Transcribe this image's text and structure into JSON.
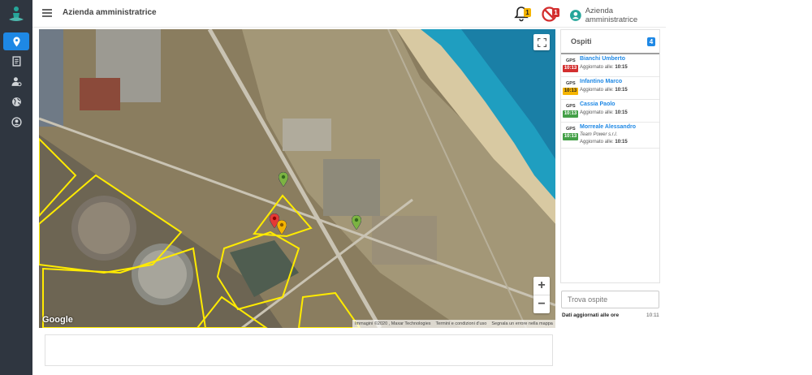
{
  "header": {
    "company": "Azienda amministratrice",
    "user_name": "Azienda amministratrice",
    "notification_count": "1",
    "blocked_count": "1"
  },
  "sidebar": {
    "items": [
      {
        "icon": "location-pin-icon",
        "active": true
      },
      {
        "icon": "document-icon"
      },
      {
        "icon": "user-settings-icon"
      },
      {
        "icon": "globe-icon"
      },
      {
        "icon": "user-circle-icon"
      }
    ]
  },
  "map": {
    "logo": "Google",
    "attribution": [
      "Immagini ©2020 , Maxar Technologies",
      "Termini e condizioni d'uso",
      "Segnala un errore nella mappa"
    ],
    "zoom_in": "+",
    "zoom_out": "−"
  },
  "guests": {
    "title": "Ospiti",
    "count": "4",
    "items": [
      {
        "gps": "GPS",
        "time": "10:13",
        "status_color": "#d32f2f",
        "name": "Bianchi Umberto",
        "company": "",
        "updated_prefix": "Aggiornato alle:",
        "updated_time": "10:15"
      },
      {
        "gps": "GPS",
        "time": "10:13",
        "status_color": "#f5b400",
        "name": "Infantino Marco",
        "company": "",
        "updated_prefix": "Aggiornato alle:",
        "updated_time": "10:15"
      },
      {
        "gps": "GPS",
        "time": "10:13",
        "status_color": "#43a047",
        "name": "Cassia Paolo",
        "company": "",
        "updated_prefix": "Aggiornato alle:",
        "updated_time": "10:15"
      },
      {
        "gps": "GPS",
        "time": "10:13",
        "status_color": "#43a047",
        "name": "Morreale Alessandro",
        "company": "Team Power s.r.l.",
        "updated_prefix": "Aggiornato alle:",
        "updated_time": "10:15"
      }
    ],
    "search_placeholder": "Trova ospite",
    "updated_label": "Dati aggiornati alle ore",
    "updated_time": "10:11"
  },
  "colors": {
    "accent": "#1e88e5",
    "sidebar": "#2f3640",
    "red": "#d32f2f",
    "yellow": "#f5b400",
    "green": "#43a047"
  }
}
